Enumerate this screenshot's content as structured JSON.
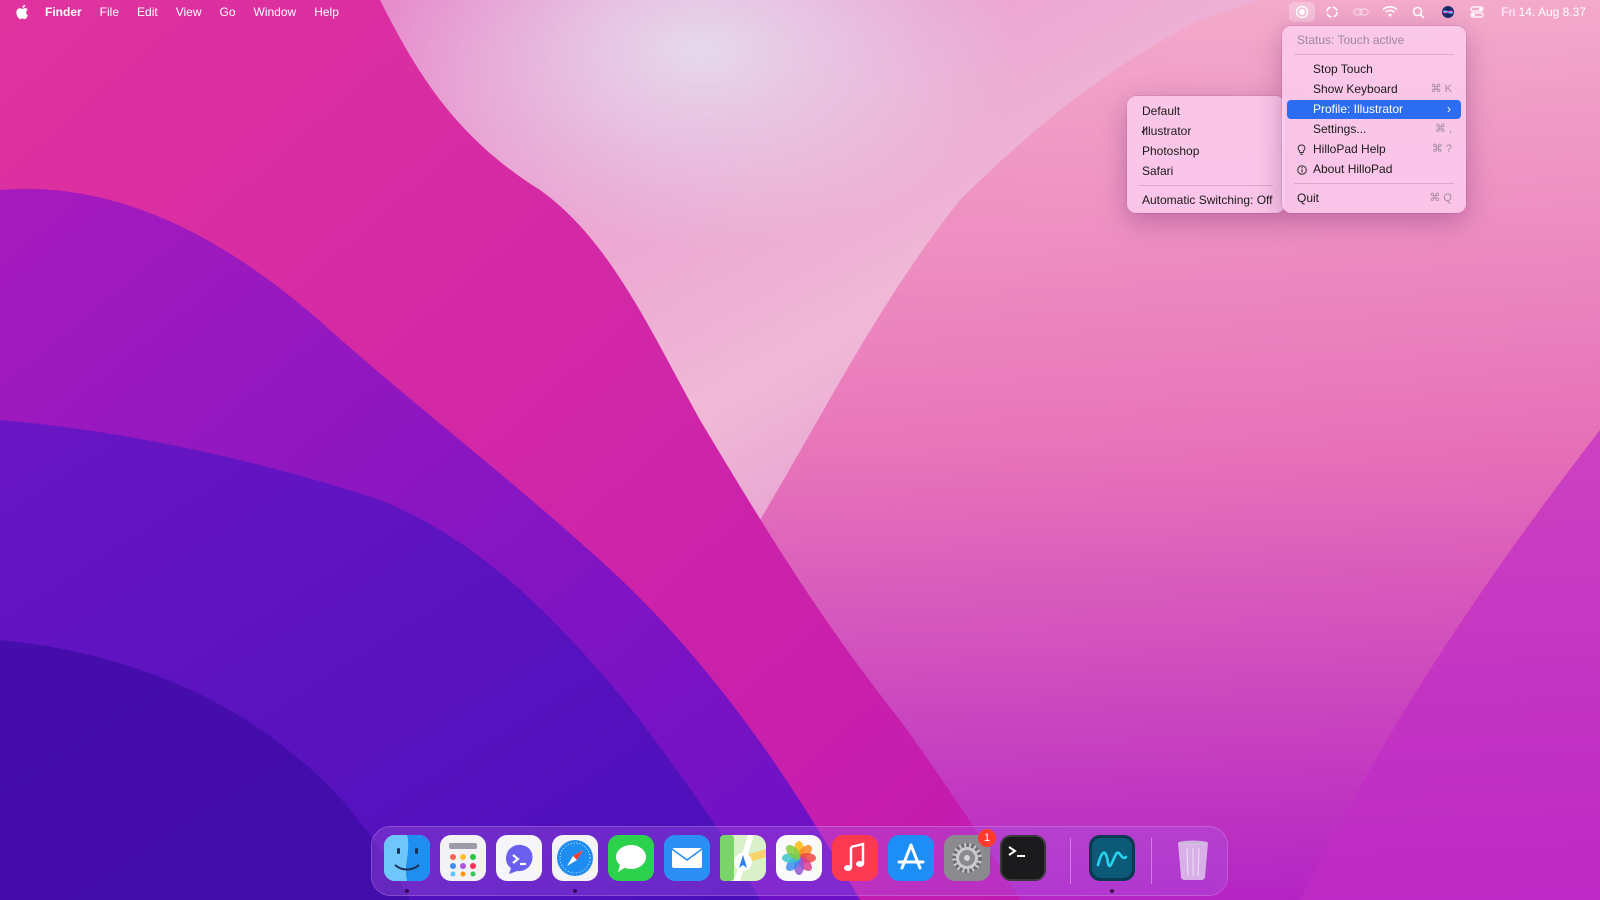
{
  "menubar": {
    "apple_icon": "apple-logo-icon",
    "app_name": "Finder",
    "menus": [
      "File",
      "Edit",
      "View",
      "Go",
      "Window",
      "Help"
    ],
    "status_icons": [
      "hillopad-status-icon",
      "sync-icon",
      "link-icon",
      "wifi-icon",
      "spotlight-search-icon",
      "siri-icon",
      "control-center-icon"
    ],
    "clock": "Fri 14. Aug  8.37"
  },
  "main_menu": {
    "status": "Status: Touch active",
    "stop_touch": "Stop Touch",
    "show_keyboard": {
      "label": "Show Keyboard",
      "shortcut": "⌘ K"
    },
    "profile": "Profile: Illustrator",
    "settings": {
      "label": "Settings...",
      "shortcut": "⌘ ,"
    },
    "help": {
      "label": "HilloPad Help",
      "shortcut": "⌘ ?"
    },
    "about": "About HilloPad",
    "quit": {
      "label": "Quit",
      "shortcut": "⌘ Q"
    }
  },
  "profile_menu": {
    "items": [
      "Default",
      "Illustrator",
      "Photoshop",
      "Safari"
    ],
    "selected": "Illustrator",
    "auto_switch": "Automatic Switching: Off"
  },
  "dock": {
    "apps": [
      "Finder",
      "Launchpad",
      "HilloPad Connect",
      "Safari",
      "Messages",
      "Mail",
      "Maps",
      "Photos",
      "Music",
      "App Store",
      "System Preferences",
      "Terminal",
      "HilloPad",
      "Trash"
    ],
    "running": [
      "Finder",
      "Safari",
      "HilloPad"
    ],
    "system_preferences_badge": "1"
  },
  "colors": {
    "accent": "#2c6cf0",
    "menu_bg": "#fccdee",
    "badge": "#ff3b30"
  }
}
